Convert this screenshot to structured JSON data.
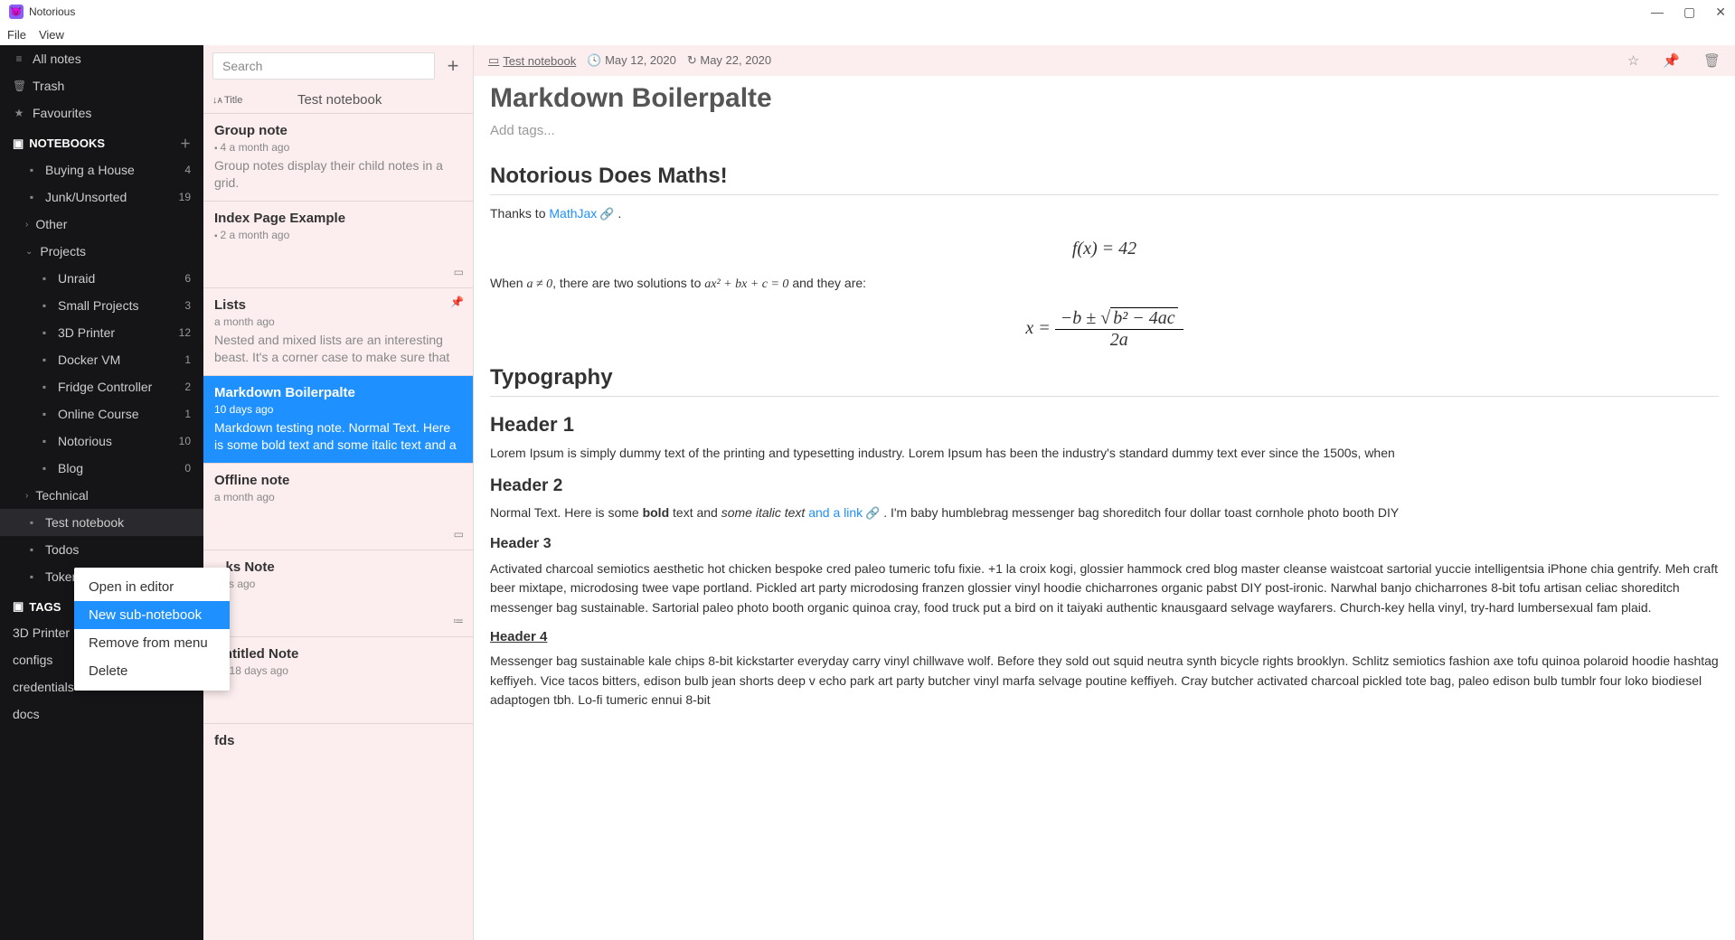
{
  "titlebar": {
    "app_name": "Notorious"
  },
  "menubar": [
    "File",
    "View"
  ],
  "sidebar": {
    "top": [
      {
        "icon": "≡",
        "label": "All notes"
      },
      {
        "icon": "🗑",
        "label": "Trash"
      },
      {
        "icon": "★",
        "label": "Favourites"
      }
    ],
    "notebooks_header": "NOTEBOOKS",
    "notebooks": [
      {
        "depth": 1,
        "icon": "📁",
        "label": "Buying a House",
        "count": "4"
      },
      {
        "depth": 1,
        "icon": "📁",
        "label": "Junk/Unsorted",
        "count": "19"
      },
      {
        "depth": 1,
        "expander": "›",
        "label": "Other",
        "count": ""
      },
      {
        "depth": 1,
        "expander": "⌄",
        "label": "Projects",
        "count": ""
      },
      {
        "depth": 2,
        "icon": "📁",
        "label": "Unraid",
        "count": "6"
      },
      {
        "depth": 2,
        "icon": "📁",
        "label": "Small Projects",
        "count": "3"
      },
      {
        "depth": 2,
        "icon": "📁",
        "label": "3D Printer",
        "count": "12"
      },
      {
        "depth": 2,
        "icon": "📁",
        "label": "Docker VM",
        "count": "1"
      },
      {
        "depth": 2,
        "icon": "📁",
        "label": "Fridge Controller",
        "count": "2"
      },
      {
        "depth": 2,
        "icon": "📁",
        "label": "Online Course",
        "count": "1"
      },
      {
        "depth": 2,
        "icon": "📁",
        "label": "Notorious",
        "count": "10"
      },
      {
        "depth": 2,
        "icon": "📁",
        "label": "Blog",
        "count": "0"
      },
      {
        "depth": 1,
        "expander": "›",
        "label": "Technical",
        "count": ""
      },
      {
        "depth": 1,
        "icon": "📁",
        "label": "Test notebook",
        "count": "",
        "selected": true
      },
      {
        "depth": 1,
        "icon": "📁",
        "label": "Todos",
        "count": ""
      },
      {
        "depth": 1,
        "icon": "📁",
        "label": "Tokens",
        "count": ""
      }
    ],
    "tags_header": "TAGS",
    "tags": [
      "3D Printer",
      "configs",
      "credentials",
      "docs"
    ]
  },
  "context_menu": {
    "items": [
      {
        "label": "Open in editor"
      },
      {
        "label": "New sub-notebook",
        "active": true
      },
      {
        "label": "Remove from menu"
      },
      {
        "label": "Delete"
      }
    ]
  },
  "notelist": {
    "search_placeholder": "Search",
    "sort_label": "Title",
    "notebook_title": "Test notebook",
    "notes": [
      {
        "title": "Group note",
        "meta": "4 a month ago",
        "meta_icon": "📁",
        "preview": "Group notes display their child notes in a grid."
      },
      {
        "title": "Index Page Example",
        "meta": "2 a month ago",
        "meta_icon": "📁",
        "preview": "",
        "right_icon": "▭"
      },
      {
        "title": "Lists",
        "meta": "a month ago",
        "right_pin": "📌",
        "preview": "Nested and mixed lists are an interesting beast. It's a corner case to make sure that Lists withi..."
      },
      {
        "title": "Markdown Boilerpalte",
        "meta": "10 days ago",
        "preview": "Markdown testing note. Normal Text. Here is some bold text and some italic text and a link....",
        "selected": true
      },
      {
        "title": "Offline note",
        "meta": "a month ago",
        "preview": "",
        "right_icon": "▭"
      },
      {
        "title": "...ks Note",
        "meta": "...ys ago",
        "preview": "",
        "right_icon": "≔"
      },
      {
        "title": "Untitled Note",
        "meta": "1 18 days ago",
        "meta_icon": "📁",
        "preview": ""
      },
      {
        "title": "fds",
        "meta": "",
        "preview": ""
      }
    ]
  },
  "main": {
    "breadcrumb": "Test notebook",
    "created": "May 12, 2020",
    "modified": "May 22, 2020",
    "title": "Markdown Boilerpalte",
    "tags_placeholder": "Add tags...",
    "content": {
      "h1_math": "Notorious Does Maths!",
      "p_mathjax_pre": "Thanks to ",
      "p_mathjax_link": "MathJax",
      "eq1": "f(x) = 42",
      "p_when_1": "When ",
      "p_when_neq": "a ≠ 0",
      "p_when_2": ", there are two solutions to ",
      "p_when_eq": "ax² + bx + c = 0",
      "p_when_3": " and they are:",
      "eq2_lhs": "x = ",
      "eq2_num": "−b ± ",
      "eq2_sqrt": "b² − 4ac",
      "eq2_den": "2a",
      "h1_typo": "Typography",
      "h2_1": "Header 1",
      "p_lorem": "Lorem Ipsum is simply dummy text of the printing and typesetting industry. Lorem Ipsum has been the industry's standard dummy text ever since the 1500s, when",
      "h3_2": "Header 2",
      "p2_a": "Normal Text. Here is some ",
      "p2_bold": "bold",
      "p2_b": " text and ",
      "p2_italic": "some italic text",
      "p2_c": "  ",
      "p2_link": "and a link",
      "p2_d": " . I'm baby humblebrag messenger bag shoreditch four dollar toast cornhole photo booth DIY",
      "h4_3": "Header 3",
      "p3": "Activated charcoal semiotics aesthetic hot chicken bespoke cred paleo tumeric tofu fixie. +1 la croix kogi, glossier hammock cred blog master cleanse waistcoat sartorial yuccie intelligentsia iPhone chia gentrify. Meh craft beer mixtape, microdosing twee vape portland. Pickled art party microdosing franzen glossier vinyl hoodie chicharrones organic pabst DIY post-ironic. Narwhal banjo chicharrones 8-bit tofu artisan celiac shoreditch messenger bag sustainable. Sartorial paleo photo booth organic quinoa cray, food truck put a bird on it taiyaki authentic knausgaard selvage wayfarers. Church-key hella vinyl, try-hard lumbersexual fam plaid.",
      "h5_4": "Header 4",
      "p4": "Messenger bag sustainable kale chips 8-bit kickstarter everyday carry vinyl chillwave wolf. Before they sold out squid neutra synth bicycle rights brooklyn. Schlitz semiotics fashion axe tofu quinoa polaroid hoodie hashtag keffiyeh. Vice tacos bitters, edison bulb jean shorts deep v echo park art party butcher vinyl marfa selvage poutine keffiyeh. Cray butcher activated charcoal pickled tote bag, paleo edison bulb tumblr four loko biodiesel adaptogen tbh. Lo-fi tumeric ennui 8-bit"
    }
  }
}
